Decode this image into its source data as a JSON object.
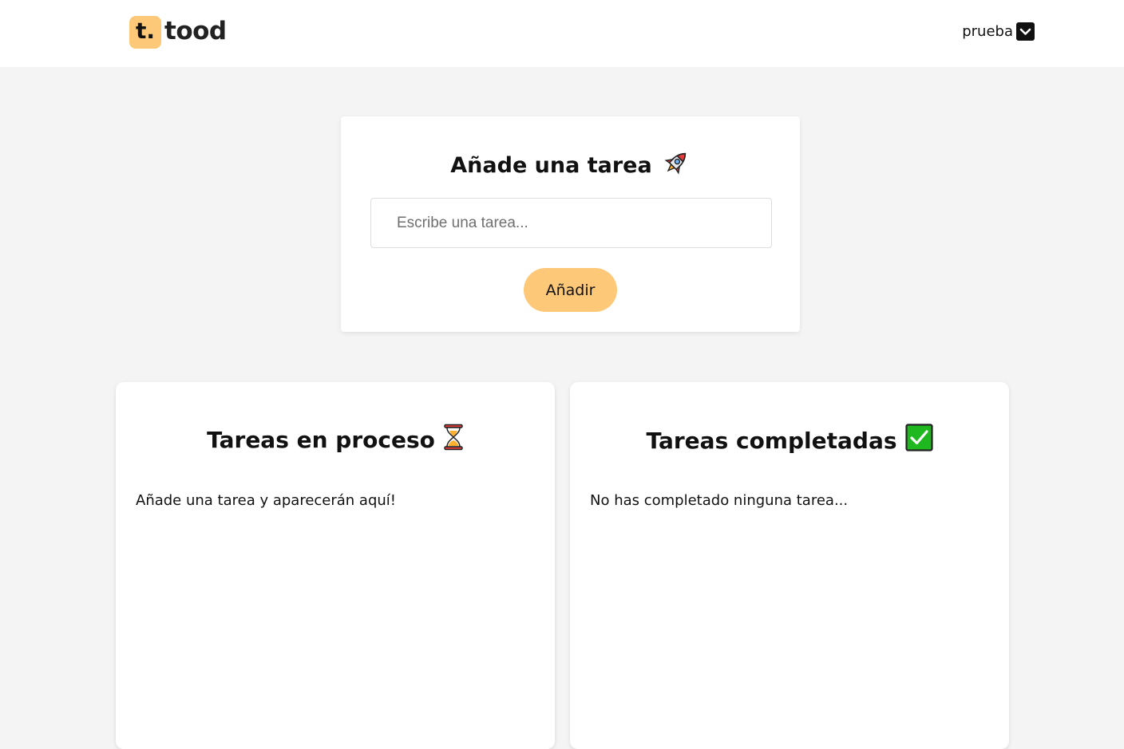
{
  "header": {
    "logo_badge": "t.",
    "logo_text": "tood",
    "user_name": "prueba",
    "user_menu_icon": "chevron-down-icon"
  },
  "add_task": {
    "title": "Añade una tarea",
    "title_icon": "rocket-icon",
    "input_placeholder": "Escribe una tarea...",
    "input_value": "",
    "button_label": "Añadir"
  },
  "in_progress": {
    "title": "Tareas en proceso",
    "title_icon": "hourglass-icon",
    "empty_text": "Añade una tarea y aparecerán aquí!",
    "tasks": []
  },
  "completed": {
    "title": "Tareas completadas",
    "title_icon": "check-box-icon",
    "empty_text": "No has completado ninguna tarea...",
    "tasks": []
  },
  "colors": {
    "accent": "#fdc878",
    "page_background": "#f4f4f4",
    "card_background": "#ffffff",
    "check_green": "#1fb81f"
  }
}
